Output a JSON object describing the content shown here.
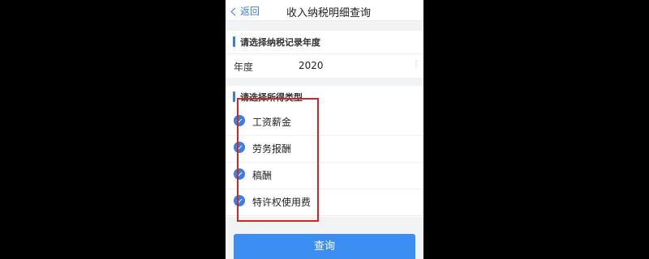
{
  "navbar": {
    "back_label": "返回",
    "title": "收入纳税明细查询"
  },
  "year_section": {
    "heading": "请选择纳税记录年度",
    "field_label": "年度",
    "field_value": "2020"
  },
  "type_section": {
    "heading": "请选择所得类型",
    "items": [
      {
        "label": "工资薪金",
        "checked": true
      },
      {
        "label": "劳务报酬",
        "checked": true
      },
      {
        "label": "稿酬",
        "checked": true
      },
      {
        "label": "特许权使用费",
        "checked": true
      }
    ]
  },
  "query_button": "查询",
  "colors": {
    "accent": "#3a7ee0",
    "button": "#3d8ef2",
    "highlight_box": "#d0252a"
  }
}
